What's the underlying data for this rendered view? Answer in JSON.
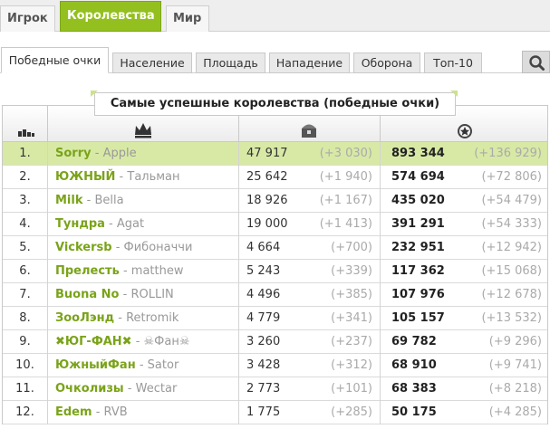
{
  "top_tabs": [
    {
      "label": "Игрок"
    },
    {
      "label": "Королевства"
    },
    {
      "label": "Мир"
    }
  ],
  "sub_tabs": [
    {
      "label": "Победные очки"
    },
    {
      "label": "Население"
    },
    {
      "label": "Площадь"
    },
    {
      "label": "Нападение"
    },
    {
      "label": "Оборона"
    },
    {
      "label": "Топ-10"
    }
  ],
  "search_icon": "search-icon",
  "table": {
    "title": "Самые успешные королевства (победные очки)",
    "header_icons": [
      "rank-icon",
      "crown-icon",
      "treasure-chest-icon",
      "victory-laurel-icon"
    ],
    "rows": [
      {
        "rank": "1.",
        "name": "Sorry",
        "owner": "Apple",
        "value": "47 917",
        "value_delta": "(+3 030)",
        "points": "893 344",
        "points_delta": "(+136 929)",
        "highlight": true
      },
      {
        "rank": "2.",
        "name": "ЮЖНЫЙ",
        "owner": "Тальман",
        "value": "25 642",
        "value_delta": "(+1 940)",
        "points": "574 694",
        "points_delta": "(+72 806)"
      },
      {
        "rank": "3.",
        "name": "Milk",
        "owner": "Bella",
        "value": "18 926",
        "value_delta": "(+1 167)",
        "points": "435 020",
        "points_delta": "(+54 479)"
      },
      {
        "rank": "4.",
        "name": "Тундра",
        "owner": "Agat",
        "value": "19 000",
        "value_delta": "(+1 413)",
        "points": "391 291",
        "points_delta": "(+54 333)"
      },
      {
        "rank": "5.",
        "name": "Vickersb",
        "owner": "Фибоначчи",
        "value": "4 664",
        "value_delta": "(+700)",
        "points": "232 951",
        "points_delta": "(+12 942)"
      },
      {
        "rank": "6.",
        "name": "Прелесть",
        "owner": "matthew",
        "value": "5 243",
        "value_delta": "(+339)",
        "points": "117 362",
        "points_delta": "(+15 068)"
      },
      {
        "rank": "7.",
        "name": "Buona No",
        "owner": "ROLLIN",
        "value": "4 496",
        "value_delta": "(+385)",
        "points": "107 976",
        "points_delta": "(+12 678)"
      },
      {
        "rank": "8.",
        "name": "ЗооЛэнд",
        "owner": "Retromik",
        "value": "4 779",
        "value_delta": "(+341)",
        "points": "105 157",
        "points_delta": "(+13 532)"
      },
      {
        "rank": "9.",
        "name": "✖ЮГ-ФАН✖",
        "owner": "☠Фан☠",
        "value": "3 260",
        "value_delta": "(+237)",
        "points": "69 782",
        "points_delta": "(+9 296)"
      },
      {
        "rank": "10.",
        "name": "ЮжныйФан",
        "owner": "Sator",
        "value": "3 428",
        "value_delta": "(+312)",
        "points": "68 910",
        "points_delta": "(+9 741)"
      },
      {
        "rank": "11.",
        "name": "Очколизы",
        "owner": "Wectar",
        "value": "2 773",
        "value_delta": "(+101)",
        "points": "68 383",
        "points_delta": "(+8 218)"
      },
      {
        "rank": "12.",
        "name": "Edem",
        "owner": "RVB",
        "value": "1 775",
        "value_delta": "(+285)",
        "points": "50 175",
        "points_delta": "(+4 285)"
      }
    ]
  },
  "colors": {
    "accent": "#93c01f",
    "kingdom_name": "#7aa319",
    "highlight_row": "#d8e9a6"
  }
}
